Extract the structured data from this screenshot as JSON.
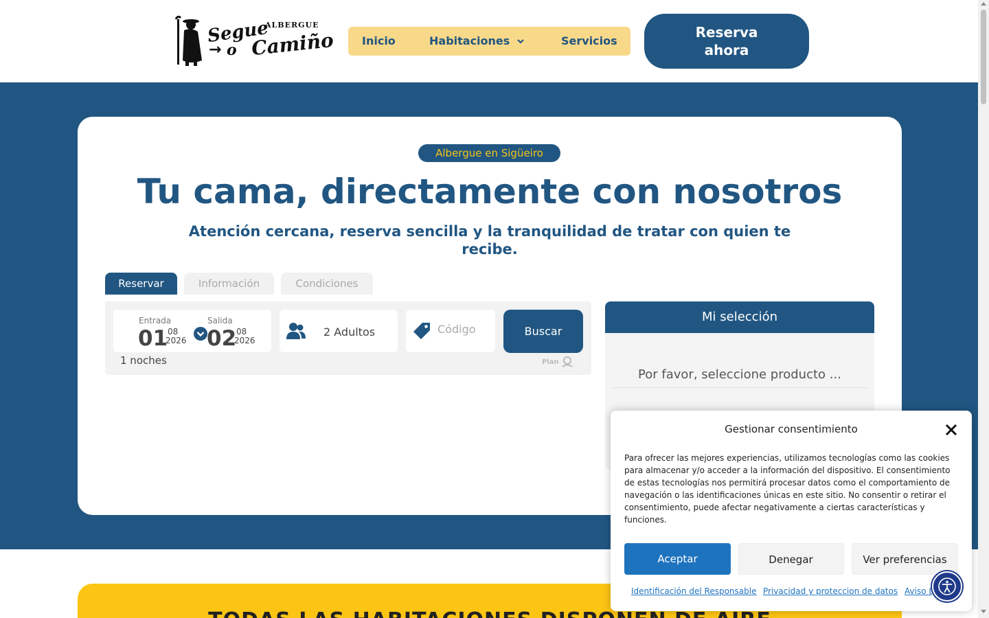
{
  "header": {
    "logo": {
      "line1": "Segue",
      "line2": "ALBERGUE",
      "line3": "Camiño",
      "line4": "o",
      "arrow": "→"
    },
    "nav": {
      "inicio": "Inicio",
      "habitaciones": "Habitaciones",
      "servicios": "Servicios"
    },
    "reserva_label": "Reserva ahora"
  },
  "hero": {
    "badge": "Albergue en Sigüeiro",
    "title": "Tu cama, directamente con nosotros",
    "subtitle": "Atención cercana, reserva sencilla y la tranquilidad de tratar con quien te recibe."
  },
  "booking": {
    "tabs": [
      "Reservar",
      "Información",
      "Condiciones"
    ],
    "entrada": {
      "label": "Entrada",
      "day": "01",
      "month": "08",
      "year": "2026"
    },
    "salida": {
      "label": "Salida",
      "day": "02",
      "month": "08",
      "year": "2026"
    },
    "nights": "1 noches",
    "guests": "2 Adultos",
    "code_placeholder": "Código",
    "search_label": "Buscar",
    "powered": "Plan"
  },
  "selection": {
    "title": "Mi selección",
    "empty": "Por favor, seleccione producto ..."
  },
  "banner": {
    "text": "TODAS LAS HABITACIONES DISPONEN DE AIRE"
  },
  "consent": {
    "title": "Gestionar consentimiento",
    "text": "Para ofrecer las mejores experiencias, utilizamos tecnologías como las cookies para almacenar y/o acceder a la información del dispositivo. El consentimiento de estas tecnologías nos permitirá procesar datos como el comportamiento de navegación o las identificaciones únicas en este sitio. No consentir o retirar el consentimiento, puede afectar negativamente a ciertas características y funciones.",
    "accept": "Aceptar",
    "deny": "Denegar",
    "prefs": "Ver preferencias",
    "links": [
      "Identificación del Responsable",
      "Privacidad y proteccion de datos",
      "Aviso Legal"
    ]
  },
  "colors": {
    "brand_blue": "#215682",
    "nav_yellow": "#f8d98a",
    "banner_yellow": "#fdc513",
    "accept_blue": "#1e73be"
  }
}
